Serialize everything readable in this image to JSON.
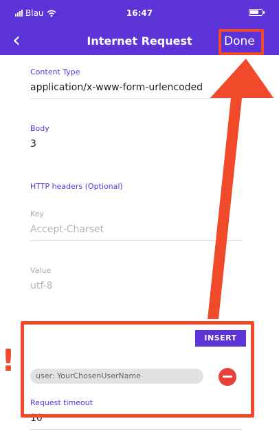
{
  "status_bar": {
    "carrier": "Blau",
    "time": "16:47"
  },
  "nav": {
    "back_glyph": "‹",
    "title": "Internet Request",
    "done_label": "Done"
  },
  "fields": {
    "content_type": {
      "label": "Content Type",
      "value": "application/x-www-form-urlencoded"
    },
    "body": {
      "label": "Body",
      "value": "3"
    },
    "http_headers": {
      "label": "HTTP headers (Optional)"
    },
    "key": {
      "label": "Key",
      "placeholder": "Accept-Charset"
    },
    "value": {
      "label": "Value",
      "placeholder": "utf-8"
    },
    "request_timeout": {
      "label": "Request timeout",
      "value": "10"
    }
  },
  "headers_editor": {
    "insert_label": "INSERT",
    "entries": [
      "user: YourChosenUserName"
    ]
  },
  "annotation": {
    "exclamation": "!"
  },
  "colors": {
    "accent": "#5b33d6",
    "highlight": "#f04a2a",
    "remove": "#e8413b"
  },
  "icons": {
    "back": "chevron-left-icon",
    "remove": "minus-circle-icon",
    "wifi": "wifi-icon",
    "battery": "battery-icon"
  }
}
